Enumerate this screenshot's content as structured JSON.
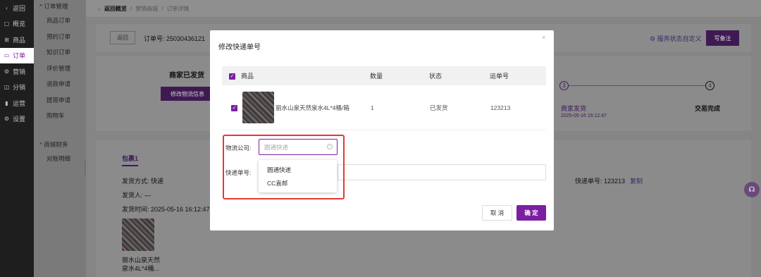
{
  "sidebar": {
    "items": [
      {
        "icon": "‹",
        "icon_name": "back-icon",
        "label": "返回"
      },
      {
        "icon": "▢",
        "icon_name": "overview-icon",
        "label": "概览"
      },
      {
        "icon": "⊞",
        "icon_name": "shop-icon",
        "label": "商品"
      },
      {
        "icon": "▭",
        "icon_name": "order-icon",
        "label": "订单"
      },
      {
        "icon": "⚙",
        "icon_name": "marketing-icon",
        "label": "营销"
      },
      {
        "icon": "◫",
        "icon_name": "distribution-icon",
        "label": "分销"
      },
      {
        "icon": "▮",
        "icon_name": "operations-icon",
        "label": "运营"
      },
      {
        "icon": "⚙",
        "icon_name": "settings-icon",
        "label": "设置"
      }
    ]
  },
  "submenu": {
    "group1": "订单管理",
    "items1": [
      "商品订单",
      "预约订单",
      "知识订单",
      "评价管理",
      "退款申请",
      "提现申请",
      "购物车"
    ],
    "group2": "商城财务",
    "items2": [
      "对账明细"
    ]
  },
  "breadcrumb": {
    "home": "返回概览",
    "sep": "/",
    "level1": "营销商城",
    "level2": "订单详情"
  },
  "header": {
    "back_btn": "返回",
    "order_label": "订单号: 25030436121",
    "service_status": "服务状态自定义",
    "note_btn": "写备注"
  },
  "status_panel": {
    "title": "商家已发货",
    "modify_btn": "修改物流信息",
    "step3_num": "3",
    "step3_label": "商家发货",
    "step3_time": "2025-05-16 16:12:47",
    "step4_num": "4",
    "step4_label": "交易完成"
  },
  "package": {
    "tab": "包裹1",
    "ship_method": "发货方式: 快递",
    "shipper": "发货人: —",
    "ship_time": "发货时间: 2025-05-16 16:12:47",
    "tracking": "快递单号: 123213",
    "copy": "复制",
    "product_name_line1": "丽水山泉天然",
    "product_name_line2": "泉水4L*4桶..."
  },
  "modal": {
    "title": "修改快递单号",
    "close": "×",
    "columns": {
      "product": "商品",
      "qty": "数量",
      "status": "状态",
      "tracking": "运单号"
    },
    "row": {
      "product": "丽水山泉天然泉水4L*4桶/箱",
      "qty": "1",
      "status": "已发货",
      "tracking": "123213"
    },
    "company_label": "物流公司:",
    "company_placeholder": "圆通快递",
    "tracking_label": "快递单号:",
    "dropdown_options": [
      "圆通快递",
      "CC直邮"
    ],
    "cancel_btn": "取 消",
    "ok_btn": "确 定"
  },
  "colors": {
    "accent": "#7b1fa2",
    "highlight": "#e53935"
  }
}
